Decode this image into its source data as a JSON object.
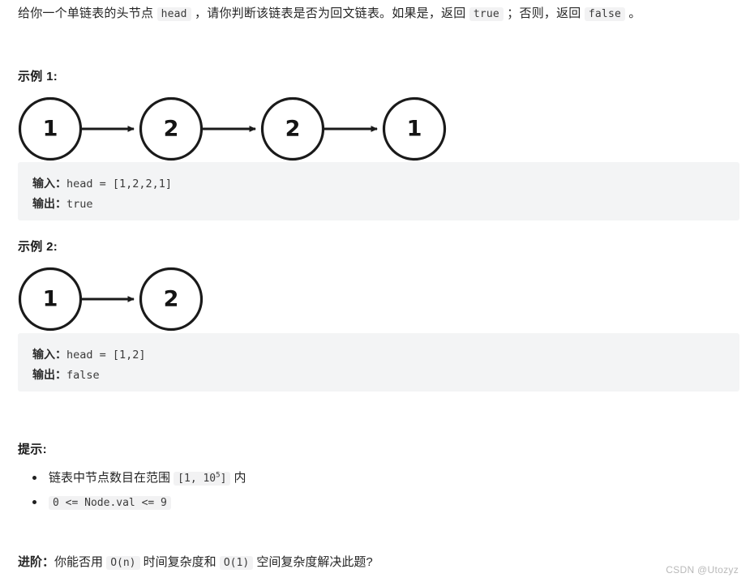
{
  "intro": {
    "part1": "给你一个单链表的头节点 ",
    "code_head": "head",
    "part2": " ，请你判断该链表是否为回文链表。如果是，返回 ",
    "code_true": "true",
    "part3": " ；否则，返回 ",
    "code_false": "false",
    "part4": " 。"
  },
  "examples": [
    {
      "title": "示例 1:",
      "input_label": "输入：",
      "input_value": "head = [1,2,2,1]",
      "output_label": "输出：",
      "output_value": "true",
      "nodes": [
        "1",
        "2",
        "2",
        "1"
      ]
    },
    {
      "title": "示例 2:",
      "input_label": "输入：",
      "input_value": "head = [1,2]",
      "output_label": "输出：",
      "output_value": "false",
      "nodes": [
        "1",
        "2"
      ]
    }
  ],
  "hints": {
    "title": "提示:",
    "items": [
      {
        "text_before": "链表中节点数目在范围 ",
        "code_base": "[1, 10",
        "code_sup": "5",
        "code_tail": "]",
        "text_after": " 内"
      },
      {
        "text_before": "",
        "code_full": "0 <= Node.val <= 9",
        "text_after": ""
      }
    ]
  },
  "followup": {
    "label": "进阶：",
    "part1": "你能否用 ",
    "code_time": "O(n)",
    "part2": " 时间复杂度和 ",
    "code_space": "O(1)",
    "part3": " 空间复杂度解决此题?"
  },
  "watermark": "CSDN @Utozyz",
  "colors": {
    "page_background": "#ffffff",
    "code_block_background": "#f3f4f5",
    "inline_code_background": "#f2f2f3",
    "text": "#262626",
    "node_stroke": "#1a1a1a",
    "watermark": "#b9b9b9"
  }
}
